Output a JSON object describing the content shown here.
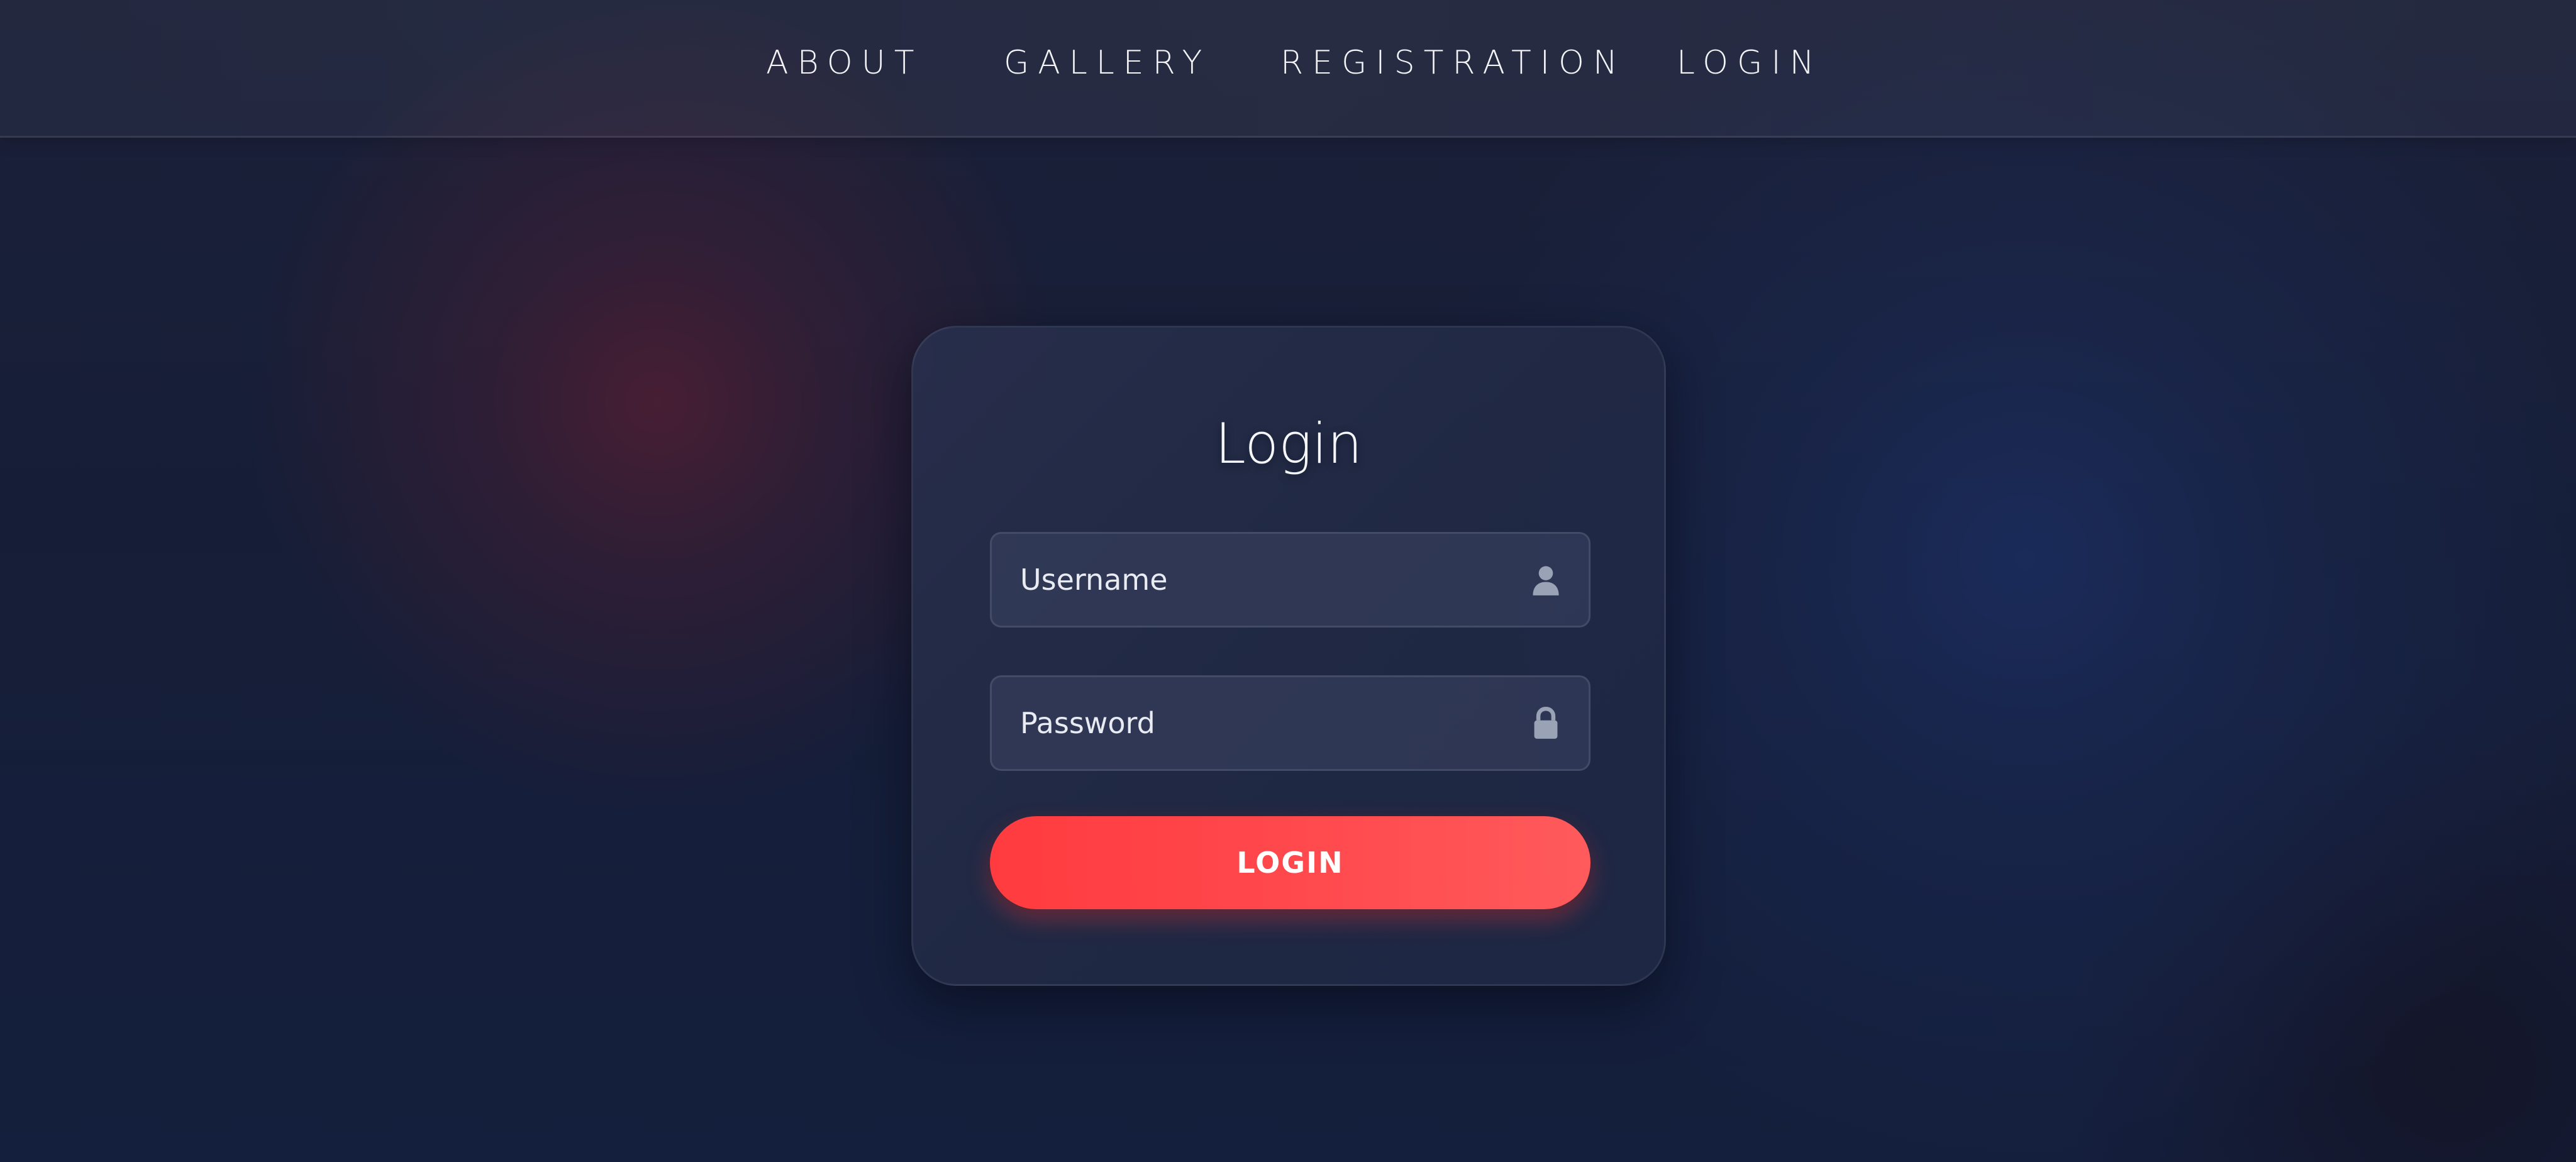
{
  "nav": {
    "items": [
      {
        "label": "ABOUT"
      },
      {
        "label": "GALLERY"
      },
      {
        "label": "REGISTRATION"
      },
      {
        "label": "LOGIN"
      }
    ]
  },
  "login_form": {
    "title": "Login",
    "username": {
      "placeholder": "Username",
      "value": "",
      "icon": "user-icon"
    },
    "password": {
      "placeholder": "Password",
      "value": "",
      "icon": "lock-icon"
    },
    "submit_label": "LOGIN"
  },
  "colors": {
    "accent": "#ff4347",
    "background": "#161e37",
    "card": "#232b46",
    "text": "#ffffff"
  }
}
